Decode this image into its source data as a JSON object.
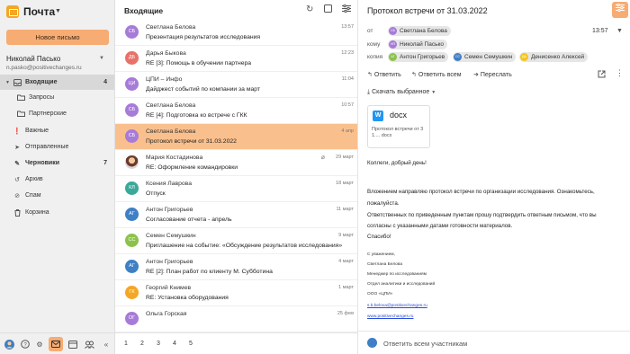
{
  "app": {
    "title": "Почта",
    "compose_label": "Новое письмо"
  },
  "account": {
    "name": "Николай Пасько",
    "email": "n.pasko@positivechanges.ru"
  },
  "colors": {
    "accent": "#f6ac72",
    "selected_row": "#f9c08e",
    "logo": "#f5a623"
  },
  "folders": [
    {
      "label": "Входящие",
      "count": "4",
      "icon": "inbox-icon"
    },
    {
      "label": "Запросы",
      "count": "",
      "icon": "folder-icon"
    },
    {
      "label": "Партнерские",
      "count": "",
      "icon": "folder-icon"
    },
    {
      "label": "Важные",
      "count": "",
      "icon": "important-icon"
    },
    {
      "label": "Отправленные",
      "count": "",
      "icon": "send-icon"
    },
    {
      "label": "Черновики",
      "count": "7",
      "icon": "draft-icon"
    },
    {
      "label": "Архив",
      "count": "",
      "icon": "archive-icon"
    },
    {
      "label": "Спам",
      "count": "",
      "icon": "spam-icon"
    },
    {
      "label": "Корзина",
      "count": "",
      "icon": "trash-icon"
    }
  ],
  "list": {
    "title": "Входящие",
    "messages": [
      {
        "initials": "СБ",
        "color": "#a77bd8",
        "sender": "Светлана Белова",
        "subject": "Презентация результатов исследования",
        "date": "13:57",
        "selected": false
      },
      {
        "initials": "ДБ",
        "color": "#e8716a",
        "sender": "Дарья Быкова",
        "subject": "RE [3]: Помощь в обучении партнера",
        "date": "12:23",
        "selected": false
      },
      {
        "initials": "ЦИ",
        "color": "#a77bd8",
        "sender": "ЦПИ – Инфо",
        "subject": "Дайджест событий по компании за март",
        "date": "11:04",
        "selected": false
      },
      {
        "initials": "СБ",
        "color": "#a77bd8",
        "sender": "Светлана Белова",
        "subject": "RE [4]: Подготовка ко встрече с ГКК",
        "date": "10:57",
        "selected": false
      },
      {
        "initials": "СБ",
        "color": "#a77bd8",
        "sender": "Светлана Белова",
        "subject": "Протокол встречи от 31.03.2022",
        "date": "4 апр",
        "selected": true
      },
      {
        "initials": "МК",
        "color": "photo",
        "sender": "Мария Костадинова",
        "subject": "RE: Оформление командировки",
        "date": "29 март",
        "selected": false
      },
      {
        "initials": "КЛ",
        "color": "#3aa89a",
        "sender": "Ксения Лаврова",
        "subject": "Отпуск",
        "date": "18 март",
        "selected": false
      },
      {
        "initials": "АГ",
        "color": "#3f7fc4",
        "sender": "Антон Григорьев",
        "subject": "Согласование отчета - апрель",
        "date": "11 март",
        "selected": false
      },
      {
        "initials": "СС",
        "color": "#8bc34a",
        "sender": "Семен Семушкин",
        "subject": "Приглашение на событие: «Обсуждение результатов исследования»",
        "date": "9 март",
        "selected": false
      },
      {
        "initials": "АГ",
        "color": "#3f7fc4",
        "sender": "Антон Григорьев",
        "subject": "RE [2]: План работ по клиенту М. Субботина",
        "date": "4 март",
        "selected": false
      },
      {
        "initials": "ГК",
        "color": "#f5a623",
        "sender": "Георгий Книмев",
        "subject": "RE: Установка оборудования",
        "date": "1 март",
        "selected": false
      },
      {
        "initials": "ОГ",
        "color": "#a77bd8",
        "sender": "Ольга Горская",
        "subject": "",
        "date": "25 фев",
        "selected": false
      }
    ],
    "pages": [
      "1",
      "2",
      "3",
      "4",
      "5"
    ]
  },
  "reader": {
    "subject": "Протокол встречи от 31.03.2022",
    "from_label": "от",
    "to_label": "кому",
    "cc_label": "копия",
    "time": "13:57",
    "from": {
      "name": "Светлана Белова",
      "initials": "СБ",
      "color": "#a77bd8"
    },
    "to": [
      {
        "name": "Николай Пасько",
        "initials": "НП",
        "color": "#a77bd8"
      }
    ],
    "cc": [
      {
        "name": "Антон Григорьев",
        "initials": "АГ",
        "color": "#8bc34a"
      },
      {
        "name": "Семен Семушкин",
        "initials": "СС",
        "color": "#3f7fc4"
      },
      {
        "name": "Денисенко Алексей",
        "initials": "ДА",
        "color": "#f5c518"
      }
    ],
    "actions": {
      "reply": "Ответить",
      "reply_all": "Ответить всем",
      "forward": "Переслать"
    },
    "download_label": "Скачать выбранное",
    "attachment": {
      "ext": "docx",
      "name": "Протокол встречи от 3 1.... docx"
    },
    "body": [
      "Коллеги, добрый день!",
      "Вложением направляю протокол встречи по организации исследования. Ознакомьтесь,",
      "пожалуйста.",
      "Ответственных по приведенным пунктам прошу подтвердить ответным письмом, что вы",
      "согласны с указанными датами готовности материалов.",
      "Спасибо!"
    ],
    "signature": [
      "С уважением,",
      "Светлана Белова",
      "Менеджер по исследованиям",
      "Отдел аналитики и исследований",
      "ООО «ЦПИ»"
    ],
    "sig_email": "s.b.belova@positivechanges.ru",
    "sig_site": "www.positivechanges.ru",
    "reply_placeholder": "Ответить всем участникам"
  }
}
